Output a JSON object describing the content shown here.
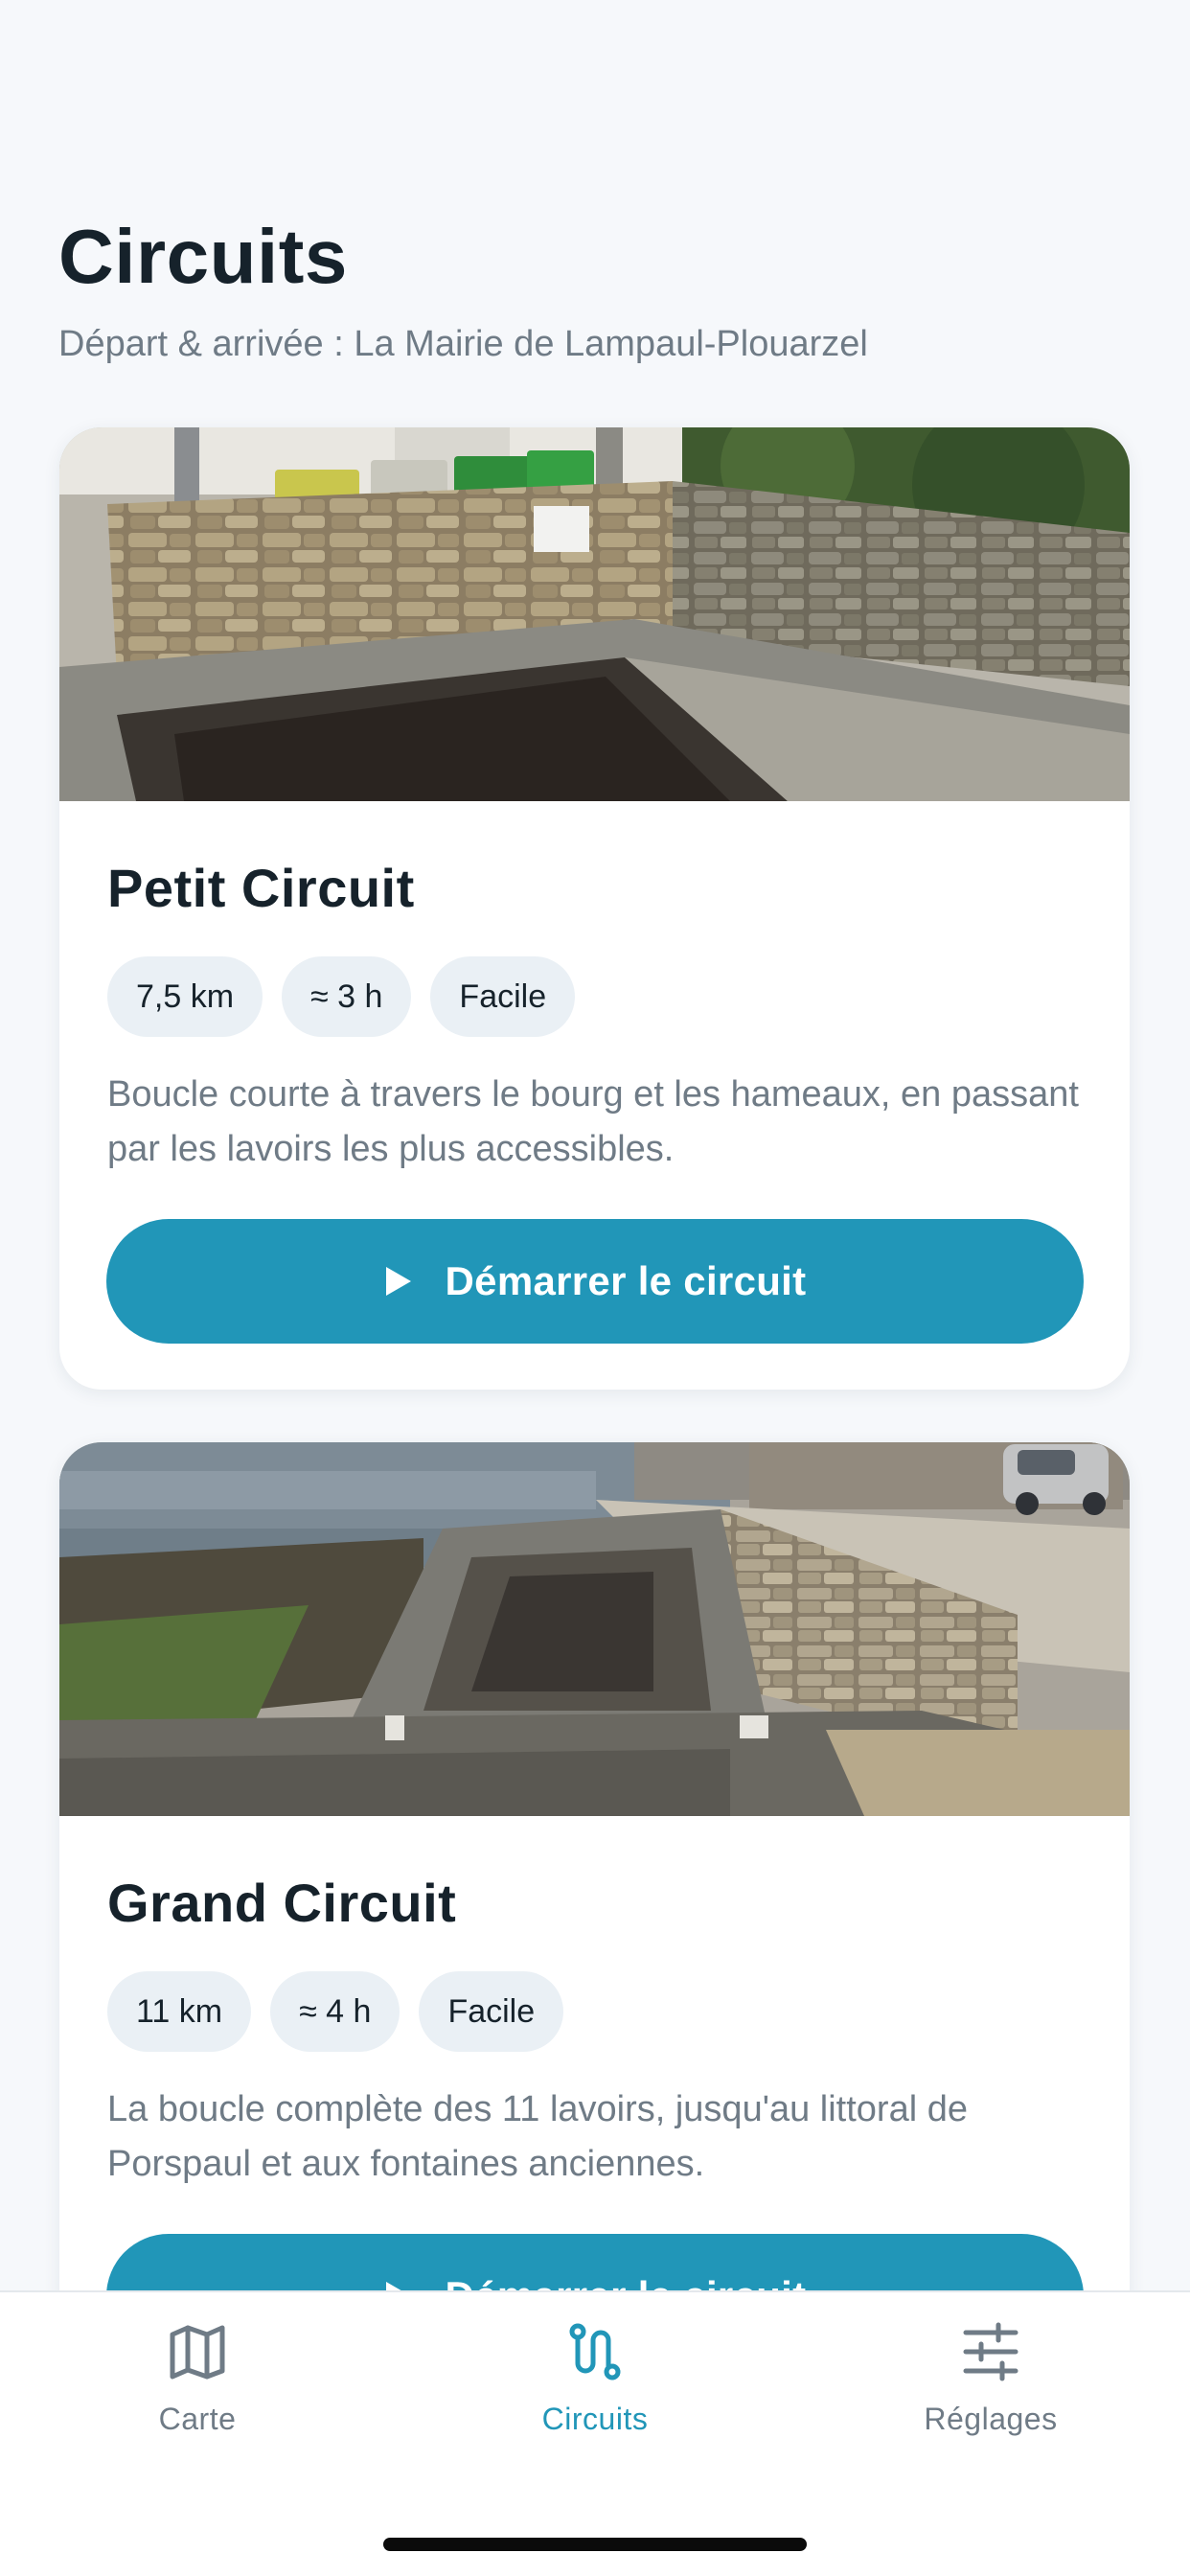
{
  "header": {
    "title": "Circuits",
    "subtitle": "Départ & arrivée : La Mairie de Lampaul-Plouarzel"
  },
  "circuits": [
    {
      "title": "Petit Circuit",
      "distance": "7,5 km",
      "duration": "≈ 3 h",
      "difficulty": "Facile",
      "description": "Boucle courte à travers le bourg et les hameaux, en passant par les lavoirs les plus accessibles.",
      "button_label": "Démarrer le circuit",
      "photo_icon": "lavoir-photo"
    },
    {
      "title": "Grand Circuit",
      "distance": "11 km",
      "duration": "≈ 4 h",
      "difficulty": "Facile",
      "description": "La boucle complète des 11 lavoirs, jusqu'au littoral de Porspaul et aux fontaines anciennes.",
      "button_label": "Démarrer le circuit",
      "photo_icon": "seaside-lavoir-photo"
    }
  ],
  "tabbar": {
    "active": "Circuits",
    "items": [
      {
        "label": "Carte",
        "icon": "map-icon"
      },
      {
        "label": "Circuits",
        "icon": "route-icon"
      },
      {
        "label": "Réglages",
        "icon": "sliders-icon"
      }
    ]
  },
  "colors": {
    "accent": "#2196b8",
    "background": "#f6f8fb",
    "chip": "#eaf0f5",
    "text": "#16222b",
    "muted": "#6f7b86"
  }
}
